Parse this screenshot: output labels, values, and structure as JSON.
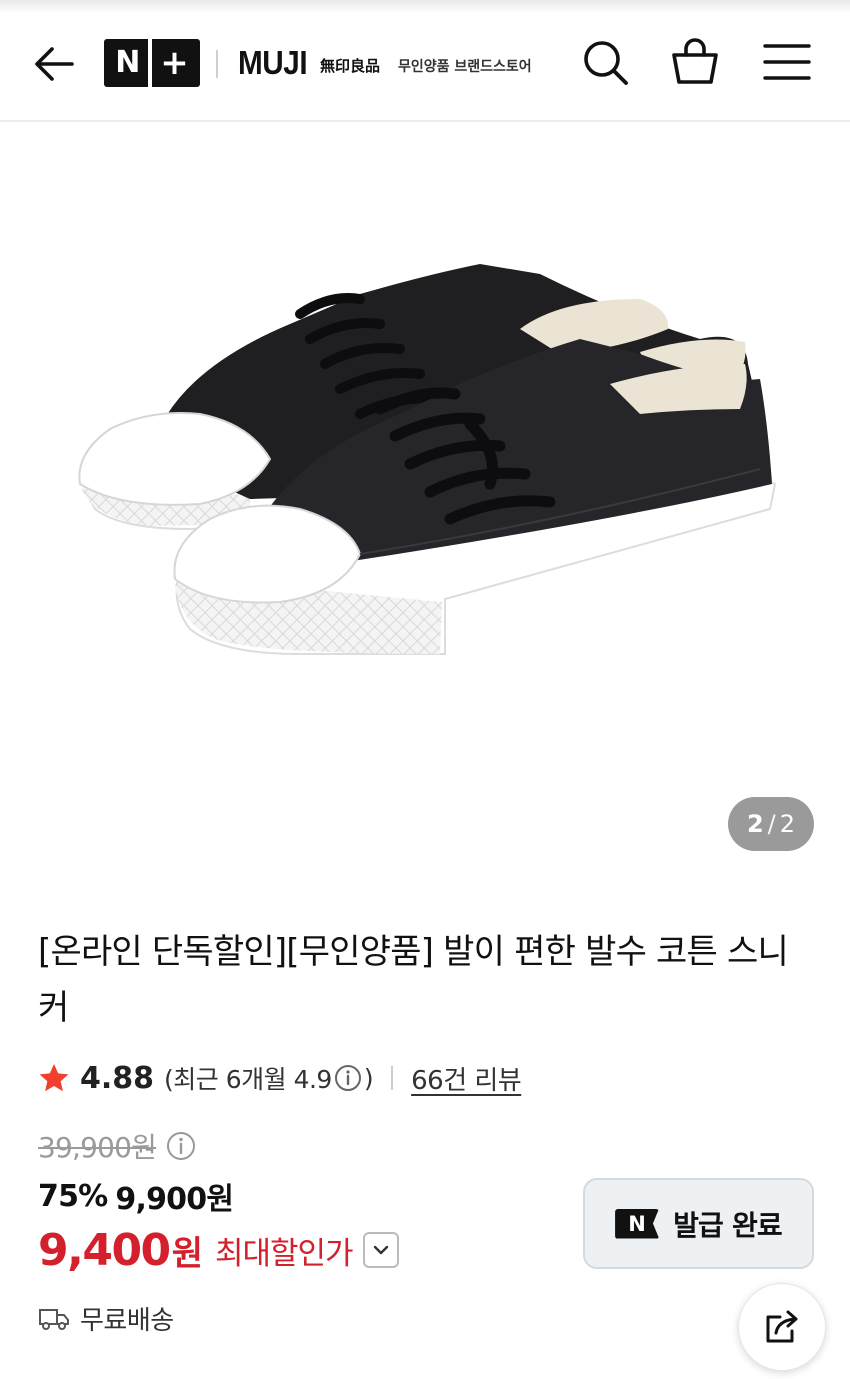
{
  "header": {
    "back_icon": "arrow-left-icon",
    "nplus_n": "N",
    "nplus_plus": "+",
    "brand": "MUJI",
    "brand_cjk": "無印良品",
    "store_label": "무인양품 브랜드스토어",
    "search_icon": "search-icon",
    "cart_icon": "shopping-bag-icon",
    "menu_icon": "hamburger-menu-icon"
  },
  "gallery": {
    "current": "2",
    "separator": "/",
    "total": "2"
  },
  "product": {
    "title": "[온라인 단독할인][무인양품] 발이 편한 발수 코튼 스니커",
    "rating": "4.88",
    "recent_prefix": "(최근 6개월 4.9",
    "recent_suffix": ")",
    "review_link": "66건 리뷰",
    "original_price": "39,900원",
    "discount_percent": "75%",
    "discount_price": "9,900원",
    "final_price": "9,400",
    "final_won": "원",
    "max_discount_label": "최대할인가"
  },
  "coupon": {
    "badge": "N",
    "label": "발급 완료"
  },
  "shipping": {
    "label": "무료배송"
  },
  "colors": {
    "accent_red": "#d4202c",
    "star": "#f0402e",
    "counter_bg": "#9a9a9a"
  }
}
